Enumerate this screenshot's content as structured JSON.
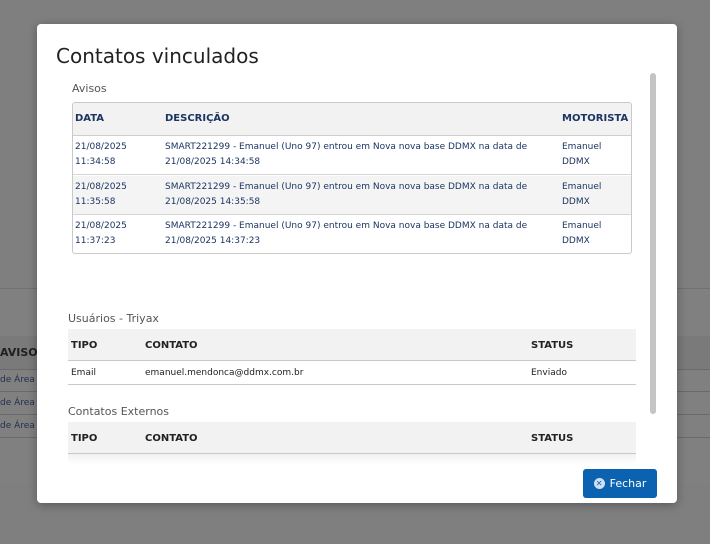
{
  "background": {
    "column_header": "AVISO",
    "rows": [
      "de Área d",
      "de Área d",
      "de Área d"
    ]
  },
  "modal": {
    "title": "Contatos vinculados",
    "close_label": "Fechar",
    "close_icon": "close-circle-icon"
  },
  "avisos": {
    "label": "Avisos",
    "headers": {
      "data": "DATA",
      "descricao": "DESCRIÇÃO",
      "motorista": "MOTORISTA"
    },
    "rows": [
      {
        "date": "21/08/2025",
        "time": "11:34:58",
        "desc1": "SMART221299 - Emanuel (Uno 97) entrou em Nova nova base DDMX na data de",
        "desc2": "21/08/2025 14:34:58",
        "driver1": "Emanuel",
        "driver2": "DDMX"
      },
      {
        "date": "21/08/2025",
        "time": "11:35:58",
        "desc1": "SMART221299 - Emanuel (Uno 97) entrou em Nova nova base DDMX na data de",
        "desc2": "21/08/2025 14:35:58",
        "driver1": "Emanuel",
        "driver2": "DDMX"
      },
      {
        "date": "21/08/2025",
        "time": "11:37:23",
        "desc1": "SMART221299 - Emanuel (Uno 97) entrou em Nova nova base DDMX na data de",
        "desc2": "21/08/2025 14:37:23",
        "driver1": "Emanuel",
        "driver2": "DDMX"
      }
    ]
  },
  "usuarios": {
    "label": "Usuários - Triyax",
    "headers": {
      "tipo": "TIPO",
      "contato": "CONTATO",
      "status": "STATUS"
    },
    "rows": [
      {
        "tipo": "Email",
        "contato": "emanuel.mendonca@ddmx.com.br",
        "status": "Enviado"
      }
    ]
  },
  "externos": {
    "label": "Contatos Externos",
    "headers": {
      "tipo": "TIPO",
      "contato": "CONTATO",
      "status": "STATUS"
    }
  }
}
